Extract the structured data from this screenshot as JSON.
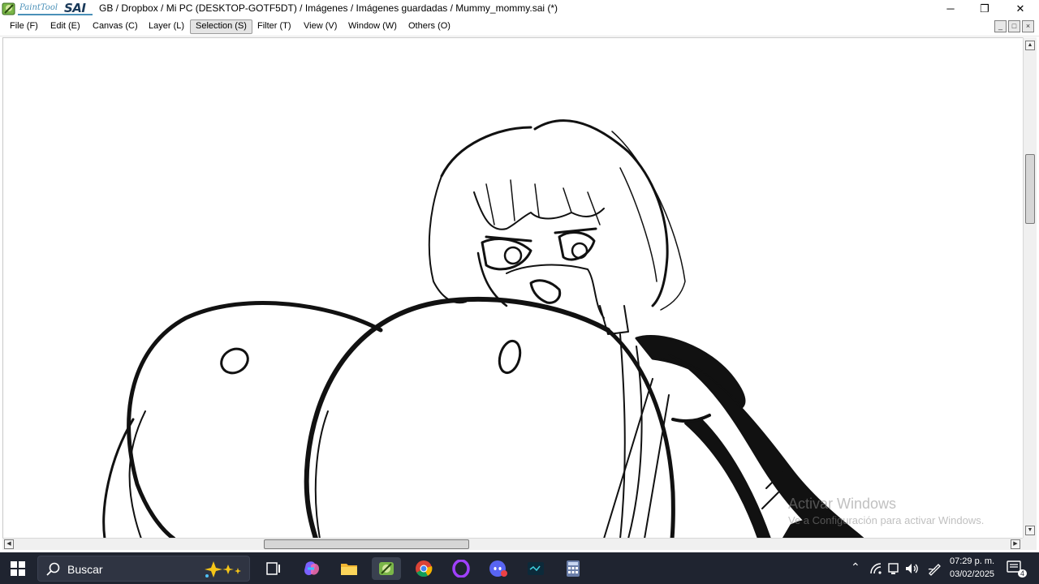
{
  "window": {
    "app_logo_text": "PaintTool",
    "app_logo_sai": "SAI",
    "title": "GB / Dropbox / Mi PC (DESKTOP-GOTF5DT) / Imágenes / Imágenes guardadas / Mummy_mommy.sai (*)",
    "minimize_glyph": "─",
    "restore_glyph": "❐",
    "close_glyph": "✕"
  },
  "menu": {
    "items": [
      {
        "label": "File (F)"
      },
      {
        "label": "Edit (E)"
      },
      {
        "label": "Canvas (C)"
      },
      {
        "label": "Layer (L)"
      },
      {
        "label": "Selection (S)"
      },
      {
        "label": "Filter (T)"
      },
      {
        "label": "View (V)"
      },
      {
        "label": "Window (W)"
      },
      {
        "label": "Others (O)"
      }
    ],
    "active_item": "Selection (S)"
  },
  "watermark": {
    "title": "Activar Windows",
    "subtitle": "Ve a Configuración para activar Windows."
  },
  "taskbar": {
    "search_placeholder": "Buscar",
    "clock_time": "07:29 p. m.",
    "clock_date": "03/02/2025",
    "notification_count": "4",
    "icons": [
      "start-icon",
      "search-icon",
      "task-view-icon",
      "copilot-icon",
      "file-explorer-icon",
      "painttool-sai-icon",
      "chrome-icon",
      "opera-gx-icon",
      "discord-icon",
      "terminal-icon",
      "calculator-icon"
    ]
  },
  "colors": {
    "taskbar_bg": "#1f2430",
    "accent": "#4a90b8"
  }
}
